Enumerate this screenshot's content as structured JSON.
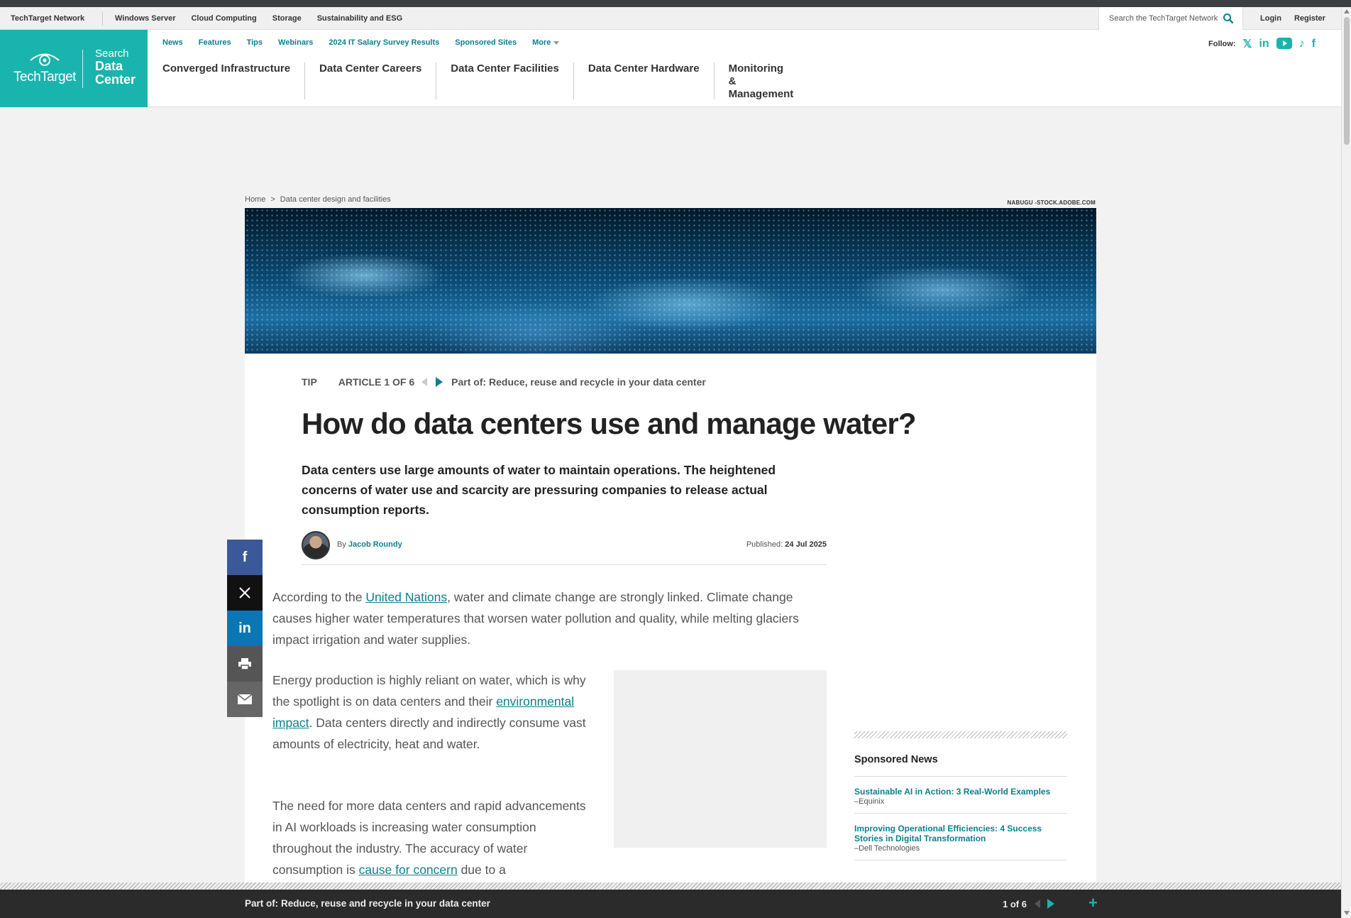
{
  "netbar": {
    "brand": "TechTarget Network",
    "links": [
      "Windows Server",
      "Cloud Computing",
      "Storage",
      "Sustainability and ESG"
    ],
    "search_placeholder": "Search the TechTarget Network",
    "login": "Login",
    "register": "Register"
  },
  "logo": {
    "company": "TechTarget",
    "site_line1": "Search",
    "site_line2": "Data",
    "site_line3": "Center"
  },
  "topnav": [
    "News",
    "Features",
    "Tips",
    "Webinars",
    "2024 IT Salary Survey Results",
    "Sponsored Sites",
    "More"
  ],
  "categories": [
    "Converged Infrastructure",
    "Data Center Careers",
    "Data Center Facilities",
    "Data Center Hardware",
    "Monitoring & Management"
  ],
  "follow": {
    "label": "Follow:",
    "icons": [
      "x-icon",
      "linkedin-icon",
      "youtube-icon",
      "tiktok-icon",
      "facebook-icon"
    ]
  },
  "breadcrumb": {
    "home": "Home",
    "separator": ">",
    "section": "Data center design and facilities"
  },
  "image_credit": "NABUGU -STOCK.ADOBE.COM",
  "article": {
    "type": "TIP",
    "series_position": "ARTICLE 1 OF 6",
    "part_of": "Part of: Reduce, reuse and recycle in your data center",
    "title": "How do data centers use and manage water?",
    "dek": "Data centers use large amounts of water to maintain operations. The heightened concerns of water use and scarcity are pressuring companies to release actual consumption reports.",
    "by_label": "By",
    "author": "Jacob Roundy",
    "published_label": "Published:",
    "published_date": "24 Jul 2025",
    "p1_before": "According to the ",
    "p1_link": "United Nations",
    "p1_after": ", water and climate change are strongly linked. Climate change causes higher water temperatures that worsen water pollution and quality, while melting glaciers impact irrigation and water supplies.",
    "p2_before": "Energy production is highly reliant on water, which is why the spotlight is on data centers and their ",
    "p2_link": "environmental impact",
    "p2_after": ". Data centers directly and indirectly consume vast amounts of electricity, heat and water.",
    "p3_before": "The need for more data centers and rapid advancements in AI workloads is increasing water consumption throughout the industry. The accuracy of water consumption is ",
    "p3_link": "cause for concern",
    "p3_after": " due to a"
  },
  "share": [
    "facebook-icon",
    "x-icon",
    "linkedin-icon",
    "print-icon",
    "email-icon"
  ],
  "sponsored": {
    "heading": "Sponsored News",
    "items": [
      {
        "title": "Sustainable AI in Action: 3 Real-World Examples",
        "source": "–Equinix"
      },
      {
        "title": "Improving Operational Efficiencies: 4 Success Stories in Digital Transformation",
        "source": "–Dell Technologies"
      }
    ]
  },
  "seriesbar": {
    "label": "Part of: Reduce, reuse and recycle in your data center",
    "count": "1 of 6",
    "expand": "+"
  },
  "colors": {
    "brand_teal": "#19b4ad",
    "link_teal": "#0d7f8e",
    "facebook": "#3b5998",
    "linkedin": "#0b76b4"
  }
}
